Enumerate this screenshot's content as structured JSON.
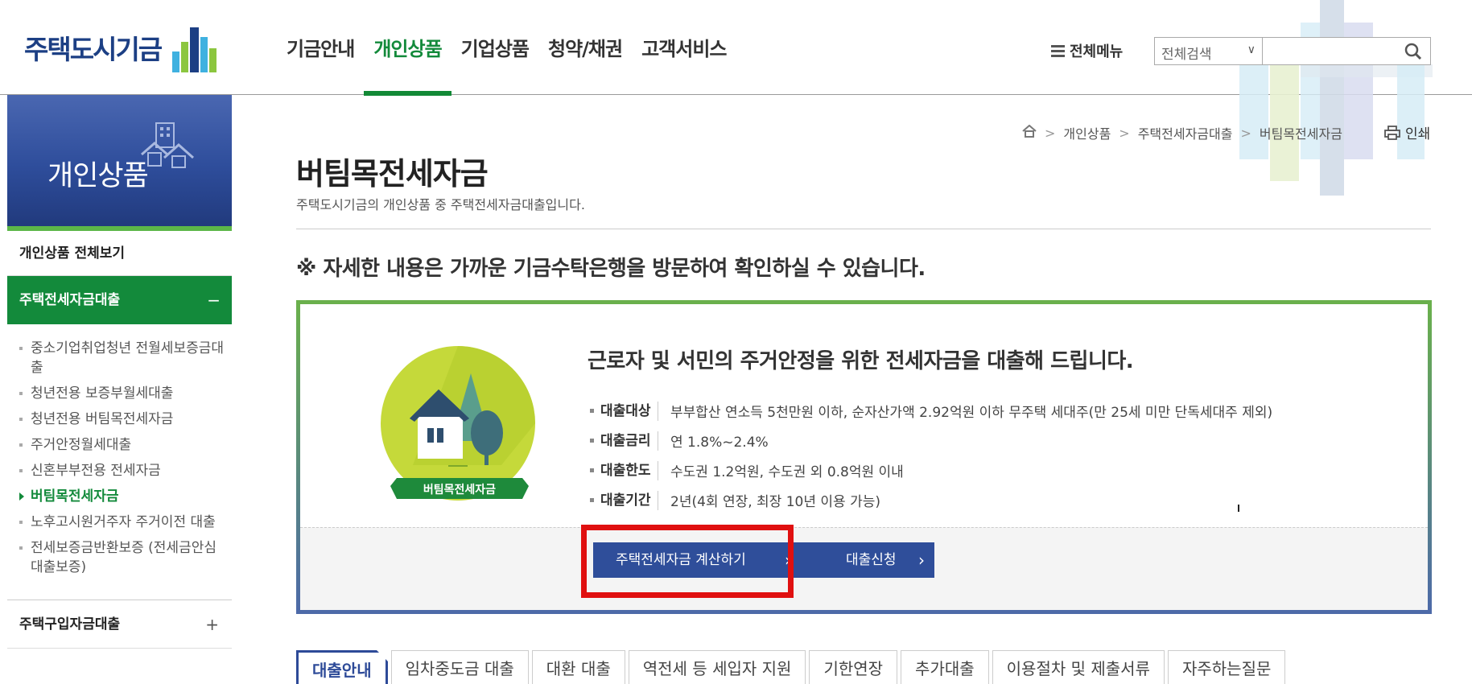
{
  "header": {
    "logo_text": "주택도시기금",
    "gnb": [
      {
        "label": "기금안내"
      },
      {
        "label": "개인상품"
      },
      {
        "label": "기업상품"
      },
      {
        "label": "청약/채권"
      },
      {
        "label": "고객서비스"
      }
    ],
    "active_gnb": "개인상품",
    "all_menu_label": "전체메뉴",
    "search_select_value": "전체검색",
    "search_placeholder": ""
  },
  "sidebar": {
    "title": "개인상품",
    "all_view": "개인상품 전체보기",
    "active_category": {
      "label": "주택전세자금대출",
      "sign": "−"
    },
    "sub_items": [
      {
        "label": "중소기업취업청년 전월세보증금대출"
      },
      {
        "label": "청년전용 보증부월세대출"
      },
      {
        "label": "청년전용 버팀목전세자금"
      },
      {
        "label": "주거안정월세대출"
      },
      {
        "label": "신혼부부전용 전세자금"
      },
      {
        "label": "버팀목전세자금"
      },
      {
        "label": "노후고시원거주자 주거이전 대출"
      },
      {
        "label": "전세보증금반환보증 (전세금안심대출보증)"
      }
    ],
    "current_item": "버팀목전세자금",
    "next_category": {
      "label": "주택구입자금대출",
      "sign": "+"
    }
  },
  "breadcrumb": [
    "개인상품",
    "주택전세자금대출",
    "버팀목전세자금"
  ],
  "print_label": "인쇄",
  "page": {
    "title": "버팀목전세자금",
    "description": "주택도시기금의 개인상품 중 주택전세자금대출입니다.",
    "notice": "※ 자세한 내용은 가까운 기금수탁은행을 방문하여 확인하실 수 있습니다."
  },
  "summary": {
    "badge": "버팀목전세자금",
    "headline": "근로자 및 서민의 주거안정을 위한 전세자금을 대출해 드립니다.",
    "info": [
      {
        "label": "대출대상",
        "value": "부부합산 연소득 5천만원 이하, 순자산가액 2.92억원 이하 무주택 세대주(만 25세 미만 단독세대주 제외)"
      },
      {
        "label": "대출금리",
        "value": "연 1.8%~2.4%"
      },
      {
        "label": "대출한도",
        "value": "수도권 1.2억원, 수도권 외 0.8억원 이내"
      },
      {
        "label": "대출기간",
        "value": "2년(4회 연장, 최장 10년 이용 가능)"
      }
    ],
    "calc_button": "주택전세자금 계산하기",
    "apply_button": "대출신청",
    "arrow": "›"
  },
  "tabs": [
    {
      "label": "대출안내"
    },
    {
      "label": "임차중도금 대출"
    },
    {
      "label": "대환 대출"
    },
    {
      "label": "역전세 등 세입자 지원"
    },
    {
      "label": "기한연장"
    },
    {
      "label": "추가대출"
    },
    {
      "label": "이용절차 및 제출서류"
    },
    {
      "label": "자주하는질문"
    }
  ],
  "colors": {
    "brand_navy": "#1c3f84",
    "brand_green": "#138a3b",
    "button_blue": "#2f4e9a",
    "highlight_red": "#e01010"
  }
}
